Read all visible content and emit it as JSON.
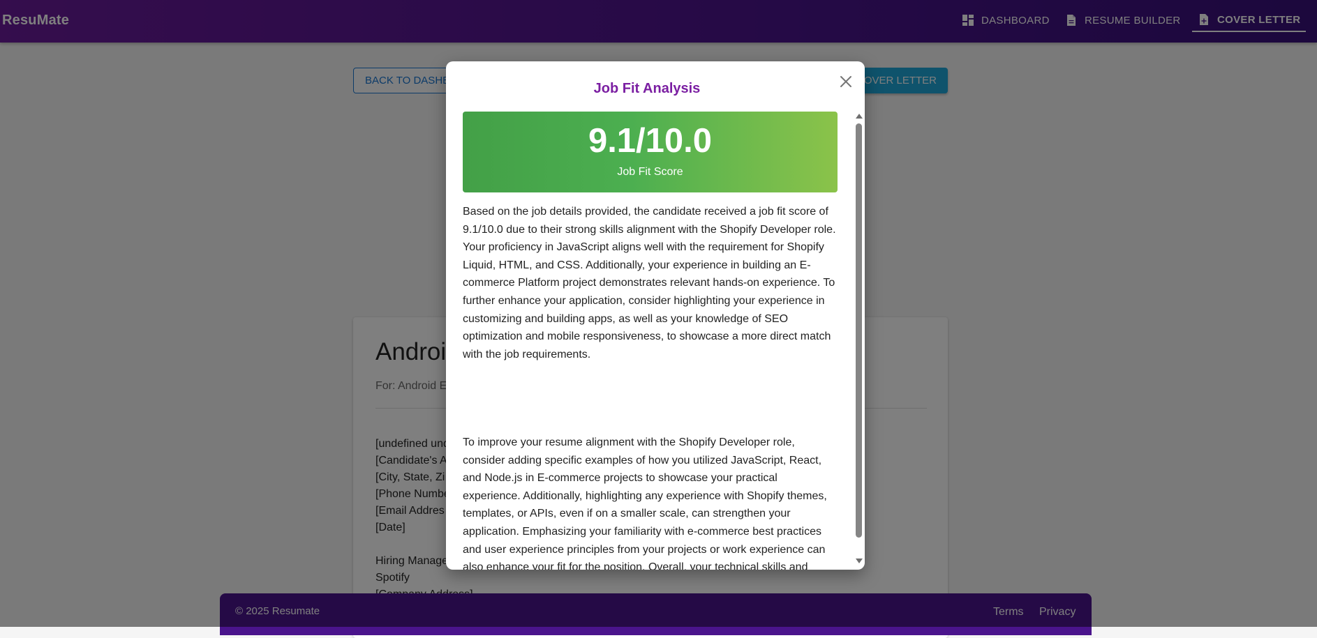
{
  "header": {
    "brand": "ResuMate",
    "nav": [
      {
        "label": "DASHBOARD",
        "icon": "dashboard-icon"
      },
      {
        "label": "RESUME BUILDER",
        "icon": "document-icon"
      },
      {
        "label": "COVER LETTER",
        "icon": "document-add-icon",
        "active": true
      }
    ]
  },
  "page": {
    "back_button": "BACK TO DASHB",
    "cover_button": "OVER LETTER",
    "doc_title": "Androi",
    "doc_subtitle": "For: Android E",
    "letter_lines": [
      "[undefined und",
      "[Candidate's A",
      "[City, State, Zi",
      "[Phone Numbe",
      "[Email Addres",
      "[Date]",
      "Hiring Manage",
      "Spotify",
      "[Company Address]"
    ]
  },
  "modal": {
    "title": "Job Fit Analysis",
    "score": "9.1/10.0",
    "score_label": "Job Fit Score",
    "paragraph_1": "Based on the job details provided, the candidate received a job fit score of 9.1/10.0 due to their strong skills alignment with the Shopify Developer role. Your proficiency in JavaScript aligns well with the requirement for Shopify Liquid, HTML, and CSS. Additionally, your experience in building an E-commerce Platform project demonstrates relevant hands-on experience. To further enhance your application, consider highlighting your experience in customizing and building apps, as well as your knowledge of SEO optimization and mobile responsiveness, to showcase a more direct match with the job requirements.",
    "paragraph_2": "To improve your resume alignment with the Shopify Developer role, consider adding specific examples of how you utilized JavaScript, React, and Node.js in E-commerce projects to showcase your practical experience. Additionally, highlighting any experience with Shopify themes, templates, or APIs, even if on a smaller scale, can strengthen your application. Emphasizing your familiarity with e-commerce best practices and user experience principles from your projects or work experience can also enhance your fit for the position. Overall, your technical skills and project experience make you a strong candidate; focusing on aligning your resume with the specific Shopify development requirements will further increase your chances of success in this role."
  },
  "footer": {
    "copyright": "© 2025 Resumate",
    "terms": "Terms",
    "privacy": "Privacy"
  },
  "colors": {
    "header": "#4a148c",
    "accent": "#7b1fa2",
    "score_start": "#43a047",
    "score_end": "#8bc34a",
    "primary": "#1976d2"
  }
}
